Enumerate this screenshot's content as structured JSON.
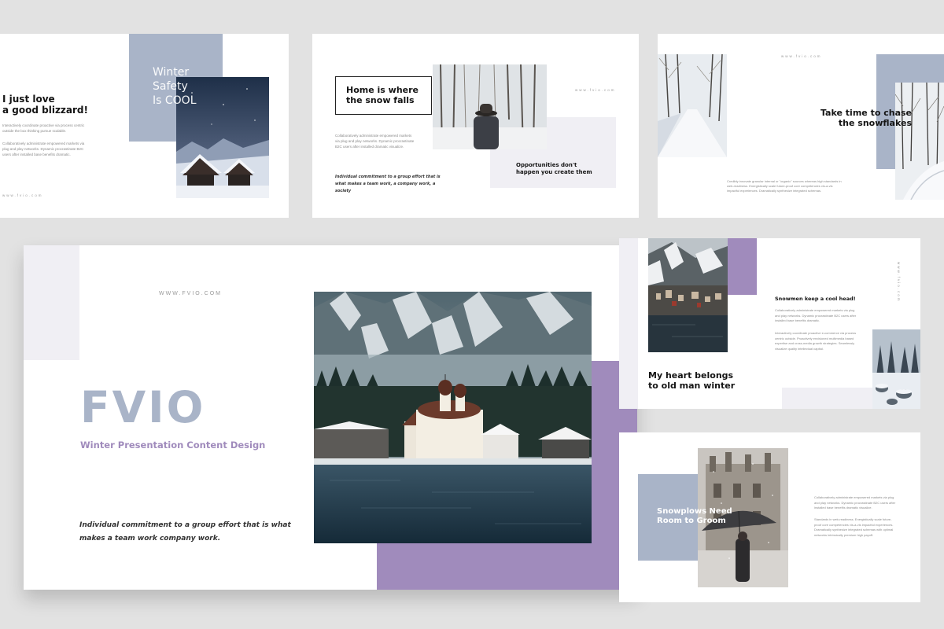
{
  "colors": {
    "background": "#e2e2e2",
    "blue_grey": "#a9b4c8",
    "lavender": "#a08bbc",
    "light_grey": "#f0eff4",
    "dark_text": "#141414"
  },
  "slide1": {
    "title": "I just love\na good blizzard!",
    "overlay": "Winter\nSafety\nIs COOL",
    "body1": "Interactively coordinate proactive via process centric outside the box thinking pursue scalable.",
    "body2": "Collaboratively administrate empowered markets via plug and play networks. Dynamic procrastinate B2C users after installed base benefits dramatic.",
    "url": "www.fvio.com"
  },
  "slide2": {
    "title": "Home is where\nthe snow falls",
    "url": "www.fvio.com",
    "body": "Collaboratively administrate empowered markets via plug and play networks. Dynamic procrastinate B2C users after installed dramatic visualize.",
    "quote": "Individual commitment to a group effort that is what makes a team work, a company work, a society",
    "box": "Opportunities don't\nhappen you create them"
  },
  "slide3": {
    "url": "www.fvio.com",
    "title": "Take time to chase\nthe snowflakes",
    "body": "Credibly innovate granular internal or \"organic\" sources whereas high standards in web-readiness. Energistically scale future-proof core competencies vis-a-vis impactful experiences. Dramatically synthesize integrated schemas."
  },
  "main": {
    "url": "WWW.FVIO.COM",
    "title": "FVIO",
    "subtitle": "Winter Presentation Content Design",
    "quote": "Individual commitment to a group effort that is what\nmakes a team work company work."
  },
  "slide5": {
    "heading": "Snowmen keep a cool head!",
    "body1": "Collaboratively administrate empowered markets via plug and play networks. Dynamic procrastinate B2C users after installed base benefits dramatic.",
    "body2": "Interactively coordinate proactive e-commerce via process centric outside. Proactively envisioned multimedia based expertise and cross-media growth strategies. Seamlessly visualize quality intellectual capital.",
    "title": "My heart belongs\nto old man winter",
    "url": "www.fvio.com"
  },
  "slide6": {
    "title": "Snowplows Need\nRoom to Groom",
    "body1": "Collaboratively administrate empowered markets via plug and play networks. Dynamic procrastinate B2C users after installed base benefits dramatic visualize.",
    "body2": "Standards in web-readiness. Energistically scale future-proof core competencies vis-a-vis impactful experiences. Dramatically synthesize integrated schemas with optimal networks intrinsically premium high payoff."
  },
  "photos": {
    "cabin": "snowy-cabin-night-photo",
    "hat": "person-in-hat-snow-forest-photo",
    "road": "snowy-tree-road-photo",
    "lake": "lake-church-mountains-photo",
    "village": "mountain-village-lake-photo",
    "trees": "snowy-forest-photo",
    "umbrella": "umbrella-in-snow-photo"
  }
}
